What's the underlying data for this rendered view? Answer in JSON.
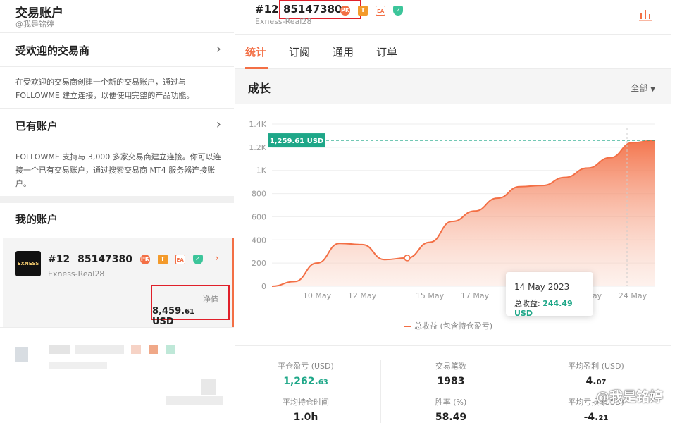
{
  "left": {
    "title": "交易账户",
    "handle": "@我是铭婷",
    "popular": {
      "title": "受欢迎的交易商",
      "desc": "在受欢迎的交易商创建一个新的交易账户，通过与 FOLLOWME 建立连接，以便使用完整的产品功能。"
    },
    "existing": {
      "title": "已有账户",
      "desc": "FOLLOWME 支持与 3,000 多家交易商建立连接。你可以连接一个已有交易账户，通过搜索交易商 MT4 服务器连接账户。"
    },
    "my_accounts": {
      "title": "我的账户",
      "account": {
        "logo_text": "EXNESS",
        "number": "#12",
        "id": "85147380",
        "server": "Exness-Real28",
        "net_label": "净值",
        "net_main": "8,459.",
        "net_dec": "61",
        "net_unit": " USD"
      }
    }
  },
  "right": {
    "num": "#12",
    "id": "85147380",
    "server": "Exness-Real28",
    "tabs": [
      "统计",
      "订阅",
      "通用",
      "订单"
    ],
    "growth_title": "成长",
    "filter": "全部",
    "legend": "总收益 (包含持仓盈亏)",
    "tooltip": {
      "date": "14 May 2023",
      "label": "总收益:",
      "value": "244.49 USD"
    },
    "stats": [
      {
        "label": "平仓盈亏 (USD)",
        "main": "1,262.",
        "dec": "63",
        "green": true
      },
      {
        "label": "交易笔数",
        "main": "1983",
        "dec": "",
        "green": false
      },
      {
        "label": "平均盈利 (USD)",
        "main": "4.",
        "dec": "07",
        "green": false
      },
      {
        "label": "平均持仓时间",
        "main": "1.0h",
        "dec": "",
        "green": false
      },
      {
        "label": "胜率 (%)",
        "main": "58.49",
        "dec": "",
        "green": false
      },
      {
        "label": "平均亏损 (USD)",
        "main": "-4.",
        "dec": "21",
        "green": false
      }
    ]
  },
  "badges": {
    "fire": "PK",
    "t": "T",
    "ea": "EA"
  },
  "watermark": "@我是铭婷",
  "colors": {
    "accent": "#f36f45",
    "green": "#1ea788",
    "highlight": "#e0202a"
  },
  "chart_data": {
    "type": "area",
    "title": "",
    "xlabel": "",
    "ylabel": "",
    "ylim": [
      0,
      1400
    ],
    "yticks": [
      "0",
      "200",
      "400",
      "600",
      "800",
      "1K",
      "1.2K",
      "1.4K"
    ],
    "xticks": [
      "10 May",
      "12 May",
      "15 May",
      "17 May",
      "22 May",
      "24 May"
    ],
    "x": [
      "8 May",
      "9 May",
      "10 May",
      "11 May",
      "12 May",
      "13 May",
      "14 May",
      "15 May",
      "16 May",
      "17 May",
      "18 May",
      "19 May",
      "20 May",
      "21 May",
      "22 May",
      "23 May",
      "24 May",
      "25 May"
    ],
    "series": [
      {
        "name": "总收益 (包含持仓盈亏)",
        "values": [
          0,
          40,
          200,
          370,
          360,
          230,
          244,
          380,
          560,
          650,
          760,
          860,
          870,
          940,
          1020,
          1110,
          1240,
          1259.61
        ]
      }
    ],
    "current_label": "1,259.61 USD",
    "current_value": 1259.61,
    "highlight_index": 6,
    "grid": true
  }
}
